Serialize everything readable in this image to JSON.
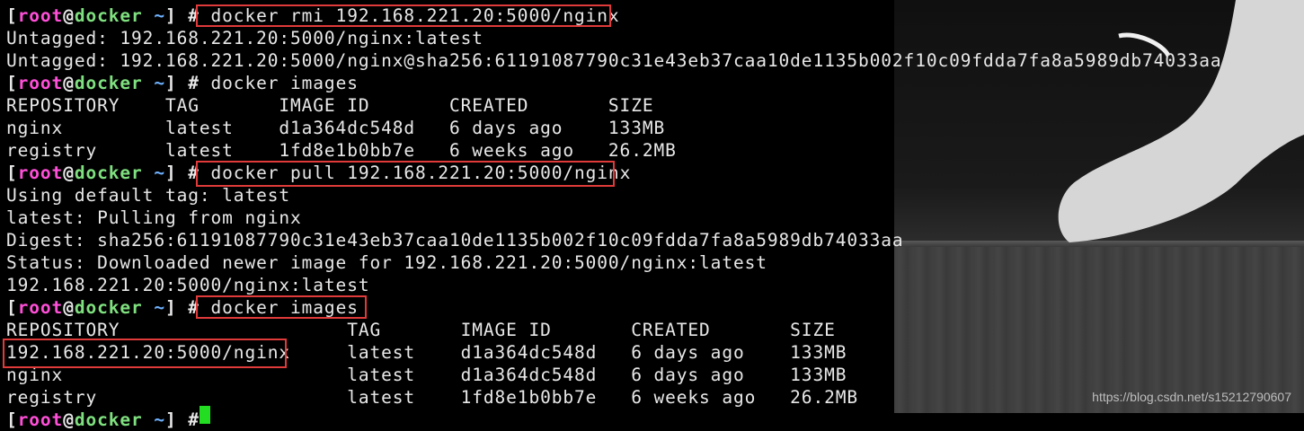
{
  "prompt": {
    "open": "[",
    "user": "root",
    "at": "@",
    "host": "docker",
    "dir": " ~",
    "close": "]",
    "symbol": " # "
  },
  "lines": [
    {
      "kind": "prompt",
      "cmd": "docker rmi 192.168.221.20:5000/nginx"
    },
    {
      "kind": "out",
      "text": "Untagged: 192.168.221.20:5000/nginx:latest"
    },
    {
      "kind": "out",
      "text": "Untagged: 192.168.221.20:5000/nginx@sha256:61191087790c31e43eb37caa10de1135b002f10c09fdda7fa8a5989db74033aa"
    },
    {
      "kind": "prompt",
      "cmd": "docker images"
    },
    {
      "kind": "out",
      "text": "REPOSITORY    TAG       IMAGE ID       CREATED       SIZE"
    },
    {
      "kind": "out",
      "text": "nginx         latest    d1a364dc548d   6 days ago    133MB"
    },
    {
      "kind": "out",
      "text": "registry      latest    1fd8e1b0bb7e   6 weeks ago   26.2MB"
    },
    {
      "kind": "prompt",
      "cmd": "docker pull 192.168.221.20:5000/nginx"
    },
    {
      "kind": "out",
      "text": "Using default tag: latest"
    },
    {
      "kind": "out",
      "text": "latest: Pulling from nginx"
    },
    {
      "kind": "out",
      "text": "Digest: sha256:61191087790c31e43eb37caa10de1135b002f10c09fdda7fa8a5989db74033aa"
    },
    {
      "kind": "out",
      "text": "Status: Downloaded newer image for 192.168.221.20:5000/nginx:latest"
    },
    {
      "kind": "out",
      "text": "192.168.221.20:5000/nginx:latest"
    },
    {
      "kind": "prompt",
      "cmd": "docker images"
    },
    {
      "kind": "out",
      "text": "REPOSITORY                    TAG       IMAGE ID       CREATED       SIZE"
    },
    {
      "kind": "out",
      "text": "192.168.221.20:5000/nginx     latest    d1a364dc548d   6 days ago    133MB"
    },
    {
      "kind": "out",
      "text": "nginx                         latest    d1a364dc548d   6 days ago    133MB"
    },
    {
      "kind": "out",
      "text": "registry                      latest    1fd8e1b0bb7e   6 weeks ago   26.2MB"
    },
    {
      "kind": "prompt",
      "cmd": ""
    }
  ],
  "watermark": "https://blog.csdn.net/s15212790607",
  "colors": {
    "background": "#000000",
    "text": "#e8e8e8",
    "user": "#ff4fd8",
    "host": "#7fe07f",
    "dir": "#6fb2ff",
    "highlight": "#e03a3a",
    "cursor": "#22dd22"
  }
}
